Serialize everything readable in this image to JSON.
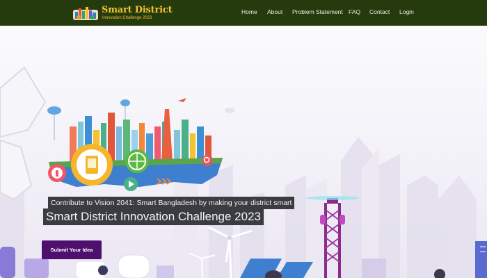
{
  "brand": {
    "title": "Smart District",
    "subtitle": "Innovation Challenge 2023",
    "logo_icon": "city-badge-icon"
  },
  "nav": {
    "items": [
      {
        "label": "Home"
      },
      {
        "label": "About"
      },
      {
        "label": "Problem Statement"
      },
      {
        "label": "FAQ"
      },
      {
        "label": "Contact"
      },
      {
        "label": "Login"
      }
    ]
  },
  "hero": {
    "tagline": "Contribute to Vision 2041: Smart Bangladesh by making your district smart",
    "title": "Smart District Innovation Challenge 2023",
    "cta_label": "Submit Your Idea",
    "illustration": "smart-city-illustration"
  },
  "colors": {
    "navbar_bg": "#263b0d",
    "brand_gold": "#f2c230",
    "nav_text": "#e9ecdf",
    "cta_bg": "#4e0f6e",
    "caption_bg": "#3b3c41"
  }
}
